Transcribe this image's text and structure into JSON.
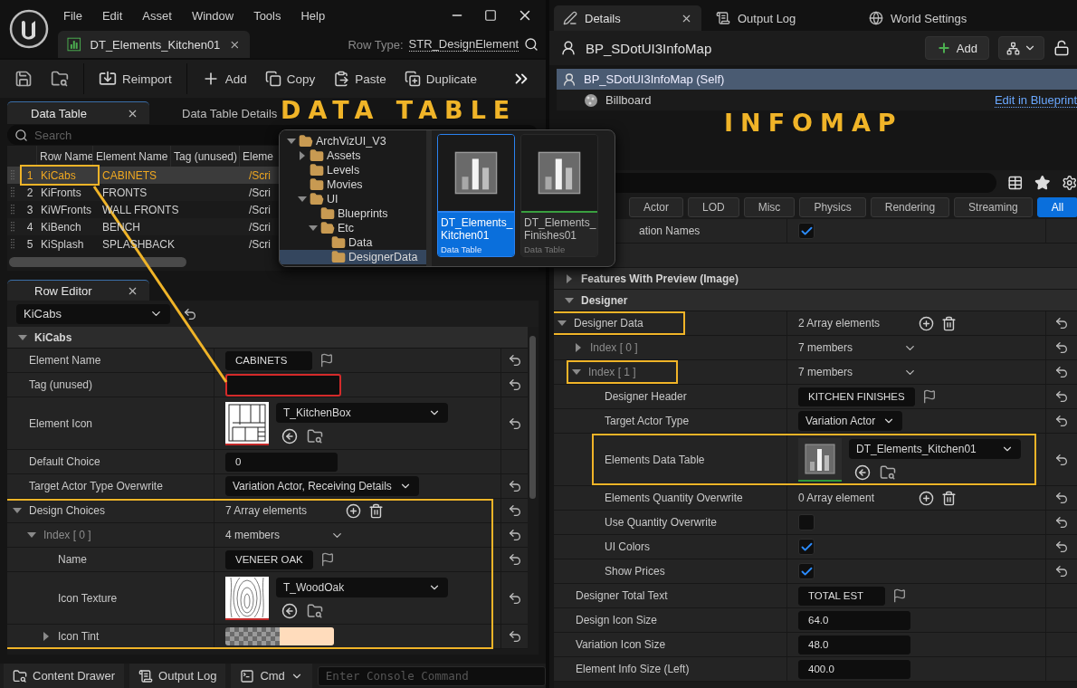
{
  "editor": {
    "menu": [
      "File",
      "Edit",
      "Asset",
      "Window",
      "Tools",
      "Help"
    ],
    "document_tab": {
      "label": "DT_Elements_Kitchen01",
      "closable": true
    },
    "row_type_label": "Row Type:",
    "row_type": "STR_DesignElement",
    "toolbar": [
      {
        "kind": "save"
      },
      {
        "kind": "browse"
      },
      {
        "kind": "reimport",
        "label": "Reimport"
      },
      {
        "kind": "add",
        "label": "Add"
      },
      {
        "kind": "copy",
        "label": "Copy"
      },
      {
        "kind": "paste",
        "label": "Paste"
      },
      {
        "kind": "duplicate",
        "label": "Duplicate"
      },
      {
        "kind": "more"
      }
    ],
    "panel_tabs": [
      {
        "label": "Data Table",
        "selected": true,
        "closable": true
      },
      {
        "label": "Data Table Details",
        "selected": false,
        "closable": false
      }
    ],
    "search": {
      "placeholder": "Search"
    },
    "table": {
      "columns": [
        "Row Name",
        "Element Name",
        "Tag (unused)",
        "Eleme"
      ],
      "rows": [
        {
          "index": "1",
          "row_name": "KiCabs",
          "element_name": "CABINETS",
          "column_4": "/Scri",
          "selected": true,
          "callout": true
        },
        {
          "index": "2",
          "row_name": "KiFronts",
          "element_name": "FRONTS",
          "column_4": "/Scri",
          "selected": false,
          "callout": false
        },
        {
          "index": "3",
          "row_name": "KiWFronts",
          "element_name": "WALL FRONTS",
          "column_4": "/Scri",
          "selected": false,
          "callout": false
        },
        {
          "index": "4",
          "row_name": "KiBench",
          "element_name": "BENCH",
          "column_4": "/Scri",
          "selected": false,
          "callout": false
        },
        {
          "index": "5",
          "row_name": "KiSplash",
          "element_name": "SPLASHBACK",
          "column_4": "/Scri",
          "selected": false,
          "callout": false
        }
      ]
    },
    "row_editor": {
      "tab": {
        "label": "Row Editor",
        "closable": true
      },
      "row_picker": "KiCabs",
      "properties": [
        {
          "kind": "category",
          "label": "KiCabs",
          "expanded": true,
          "children": [
            {
              "kind": "text",
              "label": "Element Name",
              "value": "CABINETS",
              "flag": true,
              "reset": true
            },
            {
              "kind": "text",
              "label": "Tag (unused)",
              "flag": false,
              "reset": true,
              "outline_field": true
            },
            {
              "kind": "asset",
              "label": "Element Icon",
              "value": "T_KitchenBox",
              "thumbnail": {
                "kind": "cabinets"
              },
              "reset": true
            },
            {
              "kind": "number",
              "label": "Default Choice",
              "value": "0",
              "reset": false
            },
            {
              "kind": "combo",
              "label": "Target Actor Type Overwrite",
              "value": "Variation Actor, Receiving Details",
              "reset": true
            },
            {
              "kind": "array",
              "label": "Design Choices",
              "value": "7 Array elements",
              "expanded": true,
              "reset": true,
              "outline_group": true,
              "children": [
                {
                  "kind": "struct",
                  "label": "Index [ 0 ]",
                  "value": "4 members",
                  "expanded": true,
                  "reset": true,
                  "children": [
                    {
                      "kind": "text",
                      "label": "Name",
                      "value": "VENEER OAK",
                      "flag": true,
                      "reset": true
                    },
                    {
                      "kind": "asset",
                      "label": "Icon Texture",
                      "value": "T_WoodOak",
                      "thumbnail": {
                        "kind": "wood"
                      },
                      "reset": true
                    },
                    {
                      "kind": "color",
                      "label": "Icon Tint",
                      "color": "#ffdcbc",
                      "expanded": false,
                      "reset": true
                    }
                  ]
                }
              ]
            }
          ]
        }
      ]
    }
  },
  "bottom_bar": {
    "content_drawer": "Content Drawer",
    "output_log": "Output Log",
    "cmd": "Cmd",
    "console": {
      "placeholder": "Enter Console Command"
    }
  },
  "details": {
    "tabs": [
      {
        "label": "Details",
        "selected": true,
        "closable": true
      },
      {
        "label": "Output Log",
        "selected": false,
        "closable": false
      },
      {
        "label": "World Settings",
        "selected": false,
        "closable": false
      }
    ],
    "actor": "BP_SDotUI3InfoMap",
    "add_button": "Add",
    "components": [
      {
        "label": "BP_SDotUI3InfoMap (Self)",
        "kind": "actor",
        "selected": true
      },
      {
        "label": "Billboard",
        "kind": "billboard",
        "selected": false
      }
    ],
    "edit_link": "Edit in Blueprint",
    "filters": [
      {
        "label": "Actor",
        "selected": false
      },
      {
        "label": "LOD",
        "selected": false
      },
      {
        "label": "Misc",
        "selected": false
      },
      {
        "label": "Physics",
        "selected": false
      },
      {
        "label": "Rendering",
        "selected": false
      },
      {
        "label": "Streaming",
        "selected": false
      },
      {
        "label": "All",
        "selected": true
      }
    ],
    "properties": [
      {
        "kind": "check",
        "label": "ation Names",
        "checked": true,
        "reset": false
      },
      {
        "kind": "category",
        "label": "Features With Preview (Image)",
        "expanded": false
      },
      {
        "kind": "category",
        "label": "Designer",
        "expanded": true,
        "children": [
          {
            "kind": "array",
            "label": "Designer Data",
            "value": "2 Array elements",
            "expanded": true,
            "reset": true,
            "outline_label": true,
            "children": [
              {
                "kind": "struct",
                "label": "Index [ 0 ]",
                "value": "7 members",
                "expanded": false,
                "reset": true
              },
              {
                "kind": "struct",
                "label": "Index [ 1 ]",
                "value": "7 members",
                "expanded": true,
                "reset": true,
                "outline_label": true,
                "children": [
                  {
                    "kind": "text",
                    "label": "Designer Header",
                    "value": "KITCHEN FINISHES",
                    "flag": true,
                    "reset": true
                  },
                  {
                    "kind": "combo",
                    "label": "Target Actor Type",
                    "value": "Variation Actor",
                    "reset": true
                  },
                  {
                    "kind": "asset",
                    "label": "Elements Data Table",
                    "value": "DT_Elements_Kitchen01",
                    "thumbnail": {
                      "kind": "data_table"
                    },
                    "reset": true,
                    "outline_row": true
                  },
                  {
                    "kind": "array",
                    "label": "Elements Quantity Overwrite",
                    "value": "0 Array element",
                    "reset": true
                  },
                  {
                    "kind": "check",
                    "label": "Use Quantity Overwrite",
                    "checked": false,
                    "reset": true
                  },
                  {
                    "kind": "check",
                    "label": "UI Colors",
                    "checked": true,
                    "reset": true
                  },
                  {
                    "kind": "check",
                    "label": "Show Prices",
                    "checked": true,
                    "reset": true
                  }
                ]
              }
            ]
          },
          {
            "kind": "text",
            "label": "Designer Total Text",
            "value": "TOTAL EST",
            "flag": true,
            "reset": false
          },
          {
            "kind": "number",
            "label": "Design Icon Size",
            "value": "64.0",
            "reset": false
          },
          {
            "kind": "number",
            "label": "Variation Icon Size",
            "value": "48.0",
            "reset": false
          },
          {
            "kind": "number",
            "label": "Element Info Size (Left)",
            "value": "400.0",
            "reset": false
          }
        ]
      }
    ]
  },
  "content_browser_popup": {
    "folders": [
      {
        "label": "ArchVizUI_V3",
        "expandable": true,
        "expanded": true,
        "selected": false,
        "children": [
          {
            "label": "Assets",
            "expandable": true,
            "expanded": false,
            "selected": false
          },
          {
            "label": "Levels",
            "expandable": false,
            "expanded": false,
            "selected": false
          },
          {
            "label": "Movies",
            "expandable": false,
            "expanded": false,
            "selected": false
          },
          {
            "label": "UI",
            "expandable": true,
            "expanded": true,
            "selected": false,
            "children": [
              {
                "label": "Blueprints",
                "expandable": false,
                "expanded": false,
                "selected": false
              },
              {
                "label": "Etc",
                "expandable": true,
                "expanded": true,
                "selected": false,
                "children": [
                  {
                    "label": "Data",
                    "expandable": false,
                    "expanded": false,
                    "selected": false
                  },
                  {
                    "label": "DesignerData",
                    "expandable": false,
                    "expanded": false,
                    "selected": true
                  }
                ]
              }
            ]
          }
        ]
      }
    ],
    "assets": [
      {
        "name": "DT_Elements_Kitchen01",
        "type": "Data Table",
        "selected": true
      },
      {
        "name": "DT_Elements_Finishes01",
        "type": "Data Table",
        "selected": false
      }
    ]
  },
  "annotations": [
    {
      "text": "DATA TABLE"
    },
    {
      "text": "INFOMAP"
    }
  ]
}
